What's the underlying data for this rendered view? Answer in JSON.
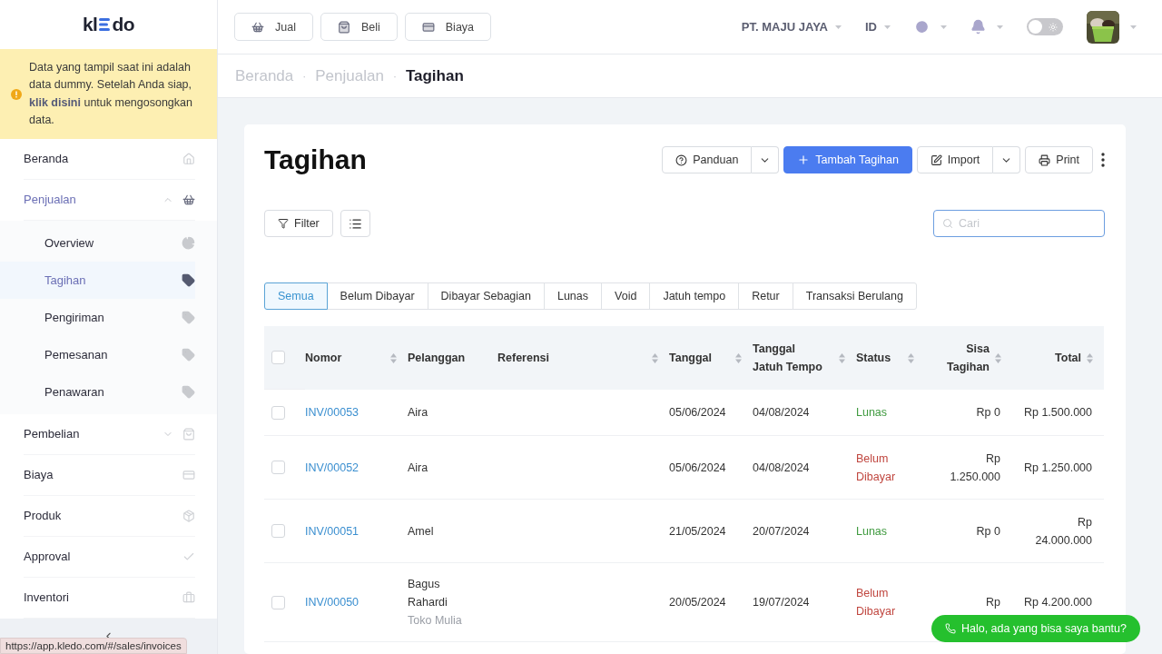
{
  "sidebar": {
    "logo": [
      "kl",
      "do"
    ],
    "notice": "Data yang tampil saat ini adalah data dummy. Setelah Anda siap, **klik disini** untuk mengosongkan data.",
    "items": [
      {
        "label": "Beranda",
        "selected": false
      },
      {
        "label": "Penjualan",
        "selected": true,
        "expanded": true,
        "children": [
          {
            "label": "Overview",
            "selected": false
          },
          {
            "label": "Tagihan",
            "selected": true
          },
          {
            "label": "Pengiriman",
            "selected": false
          },
          {
            "label": "Pemesanan",
            "selected": false
          },
          {
            "label": "Penawaran",
            "selected": false
          }
        ]
      },
      {
        "label": "Pembelian",
        "selected": false,
        "expanded": false
      },
      {
        "label": "Biaya",
        "selected": false
      },
      {
        "label": "Produk",
        "selected": false
      },
      {
        "label": "Approval",
        "selected": false
      },
      {
        "label": "Inventori",
        "selected": false
      }
    ]
  },
  "topbar": {
    "quick_buttons": [
      "Jual",
      "Beli",
      "Biaya"
    ],
    "company": "PT. MAJU JAYA",
    "language": "ID",
    "theme_toggle": {
      "on": false
    }
  },
  "breadcrumb": {
    "items": [
      "Beranda",
      "Penjualan",
      "Tagihan"
    ],
    "separator": "·"
  },
  "page": {
    "title": "Tagihan",
    "actions": [
      {
        "kind": "help",
        "label": "Panduan",
        "split": true
      },
      {
        "kind": "primary",
        "label": "Tambah Tagihan",
        "split": false
      },
      {
        "kind": "import",
        "label": "Import",
        "split": true
      },
      {
        "kind": "print",
        "label": "Print",
        "split": false
      }
    ],
    "filter_button": "Filter",
    "search": {
      "placeholder": "Cari"
    },
    "tabs": [
      {
        "label": "Semua",
        "selected": true
      },
      {
        "label": "Belum Dibayar",
        "selected": false
      },
      {
        "label": "Dibayar Sebagian",
        "selected": false
      },
      {
        "label": "Lunas",
        "selected": false
      },
      {
        "label": "Void",
        "selected": false
      },
      {
        "label": "Jatuh tempo",
        "selected": false
      },
      {
        "label": "Retur",
        "selected": false
      },
      {
        "label": "Transaksi Berulang",
        "selected": false
      }
    ],
    "table": {
      "select_all": {
        "checked": false
      },
      "columns": [
        {
          "label": "Nomor",
          "sortable": true
        },
        {
          "label": "Pelanggan",
          "sortable": false
        },
        {
          "label": "Referensi",
          "sortable": true
        },
        {
          "label": "Tanggal",
          "sortable": true
        },
        {
          "label": "Tanggal Jatuh Tempo",
          "sortable": true
        },
        {
          "label": "Status",
          "sortable": true
        },
        {
          "label": "Sisa Tagihan",
          "sortable": true
        },
        {
          "label": "Total",
          "sortable": true
        }
      ],
      "rows": [
        {
          "checked": false,
          "nomor": "INV/00053",
          "pelanggan": "Aira",
          "tanggal": "05/06/2024",
          "jatuh_tempo": "04/08/2024",
          "status": {
            "label": "Lunas",
            "kind": "paid"
          },
          "sisa": "Rp 0",
          "total": "Rp 1.500.000"
        },
        {
          "checked": false,
          "nomor": "INV/00052",
          "pelanggan": "Aira",
          "tanggal": "05/06/2024",
          "jatuh_tempo": "04/08/2024",
          "status": {
            "label": "Belum Dibayar",
            "kind": "unpaid"
          },
          "sisa": "Rp 1.250.000",
          "total": "Rp 1.250.000"
        },
        {
          "checked": false,
          "nomor": "INV/00051",
          "pelanggan": "Amel",
          "tanggal": "21/05/2024",
          "jatuh_tempo": "20/07/2024",
          "status": {
            "label": "Lunas",
            "kind": "paid"
          },
          "sisa": "Rp 0",
          "total": "Rp 24.000.000"
        },
        {
          "checked": false,
          "nomor": "INV/00050",
          "pelanggan": "Bagus Rahardi",
          "pelanggan_sub": "Toko Mulia",
          "tanggal": "20/05/2024",
          "jatuh_tempo": "19/07/2024",
          "status": {
            "label": "Belum Dibayar",
            "kind": "unpaid"
          },
          "sisa": "Rp",
          "total": "Rp 4.200.000"
        }
      ]
    }
  },
  "chat_button": "Halo, ada yang bisa saya bantu?",
  "status_url": "https://app.kledo.com/#/sales/invoices"
}
